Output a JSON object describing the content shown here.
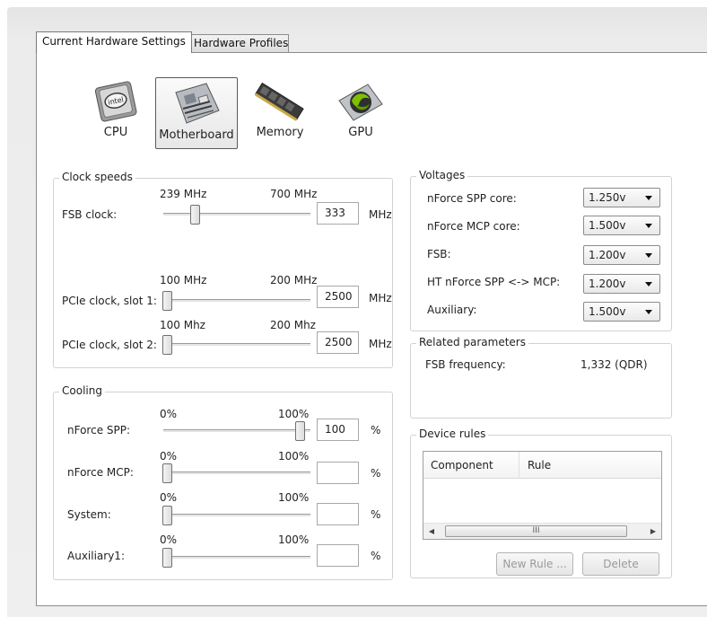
{
  "tabs": [
    {
      "label": "Current Hardware Settings",
      "active": true
    },
    {
      "label": "Hardware Profiles",
      "active": false
    }
  ],
  "hardware": [
    {
      "label": "CPU",
      "icon": "cpu-icon"
    },
    {
      "label": "Motherboard",
      "icon": "motherboard-icon",
      "selected": true
    },
    {
      "label": "Memory",
      "icon": "memory-icon"
    },
    {
      "label": "GPU",
      "icon": "gpu-icon"
    }
  ],
  "clock": {
    "title": "Clock speeds",
    "fsb": {
      "label": "FSB clock:",
      "min": "239 MHz",
      "max": "700 MHz",
      "value": "333",
      "unit": "MHz"
    },
    "pcie1": {
      "label": "PCIe clock, slot 1:",
      "min": "100 MHz",
      "max": "200 MHz",
      "value": "2500",
      "unit": "MHz"
    },
    "pcie2": {
      "label": "PCIe clock, slot 2:",
      "min": "100 Mhz",
      "max": "200 Mhz",
      "value": "2500",
      "unit": "MHz"
    }
  },
  "cooling": {
    "title": "Cooling",
    "spp": {
      "label": "nForce SPP:",
      "min": "0%",
      "max": "100%",
      "value": "100",
      "unit": "%",
      "level": 1.0
    },
    "mcp": {
      "label": "nForce MCP:",
      "min": "0%",
      "max": "100%",
      "value": "",
      "unit": "%",
      "level": 0.0
    },
    "system": {
      "label": "System:",
      "min": "0%",
      "max": "100%",
      "value": "",
      "unit": "%",
      "level": 0.0
    },
    "aux1": {
      "label": "Auxiliary1:",
      "min": "0%",
      "max": "100%",
      "value": "",
      "unit": "%",
      "level": 0.0
    }
  },
  "voltages": {
    "title": "Voltages",
    "items": [
      {
        "label": "nForce SPP core:",
        "value": "1.250v"
      },
      {
        "label": "nForce MCP core:",
        "value": "1.500v"
      },
      {
        "label": "FSB:",
        "value": "1.200v"
      },
      {
        "label": "HT nForce SPP <-> MCP:",
        "value": "1.200v"
      },
      {
        "label": "Auxiliary:",
        "value": "1.500v"
      }
    ]
  },
  "related": {
    "title": "Related parameters",
    "label": "FSB frequency:",
    "value": "1,332 (QDR)"
  },
  "rules": {
    "title": "Device rules",
    "columns": [
      "Component",
      "Rule"
    ],
    "scroll_grip": "III",
    "new_rule": "New Rule ...",
    "delete": "Delete"
  }
}
